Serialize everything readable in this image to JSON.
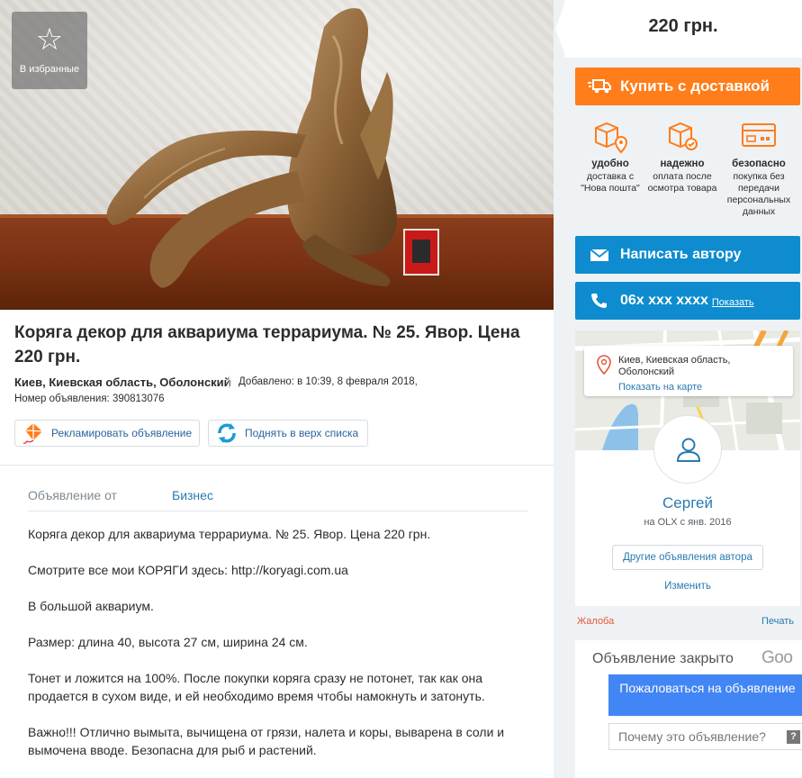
{
  "favorite": {
    "label": "В избранные"
  },
  "listing": {
    "title": "Коряга декор для аквариума террариума. № 25. Явор. Цена 220 грн.",
    "location": "Киев, Киевская область, Оболонский",
    "added": "Добавлено: в 10:39, 8 февраля 2018,",
    "id_line": "Номер объявления: 390813076"
  },
  "promo": {
    "advertise_label": "Рекламировать объявление",
    "raise_label": "Поднять в верх списка"
  },
  "details": {
    "offer_from_label": "Объявление от",
    "offer_from_value": "Бизнес"
  },
  "description": [
    "Коряга декор для аквариума террариума. № 25. Явор. Цена 220 грн.",
    "Смотрите все мои КОРЯГИ здесь: http://koryagi.com.ua",
    "В большой аквариум.",
    "Размер: длина 40, высота 27 см, ширина 24 см.",
    "Тонет и ложится на 100%. После покупки коряга сразу не потонет, так как она продается в сухом виде, и ей необходимо время чтобы намокнуть и затонуть.",
    "Важно!!! Отлично вымыта, вычищена от грязи, налета и коры, выварена в соли и вымочена вводе. Безопасна для рыб и растений."
  ],
  "sidebar": {
    "price": "220 грн.",
    "buy_label": "Купить с доставкой",
    "features": [
      {
        "title": "удобно",
        "text": "доставка с \"Нова пошта\"",
        "icon": "delivery-box-pin-icon"
      },
      {
        "title": "надежно",
        "text": "оплата после осмотра товара",
        "icon": "box-check-icon"
      },
      {
        "title": "безопасно",
        "text": "покупка без передачи персональных данных",
        "icon": "card-icon"
      }
    ],
    "write_label": "Написать автору",
    "phone_label": "06x xxx xxxx",
    "phone_show": "Показать",
    "map_address": "Киев, Киевская область, Оболонский",
    "map_link": "Показать на карте",
    "seller_name": "Сергей",
    "seller_since": "на OLX с янв. 2016",
    "other_ads": "Другие объявления автора",
    "edit": "Изменить",
    "complain": "Жалоба",
    "print": "Печать"
  },
  "google": {
    "closed_title": "Объявление закрыто",
    "logo": "Goo",
    "report_label": "Пожаловаться на объявление",
    "why_label": "Почему это объявление?",
    "why_mark": "?"
  },
  "colors": {
    "accent_orange": "#ff7d1a",
    "accent_blue": "#0e8ccf",
    "link_blue": "#2a7ab0",
    "google_blue": "#4285f4"
  }
}
